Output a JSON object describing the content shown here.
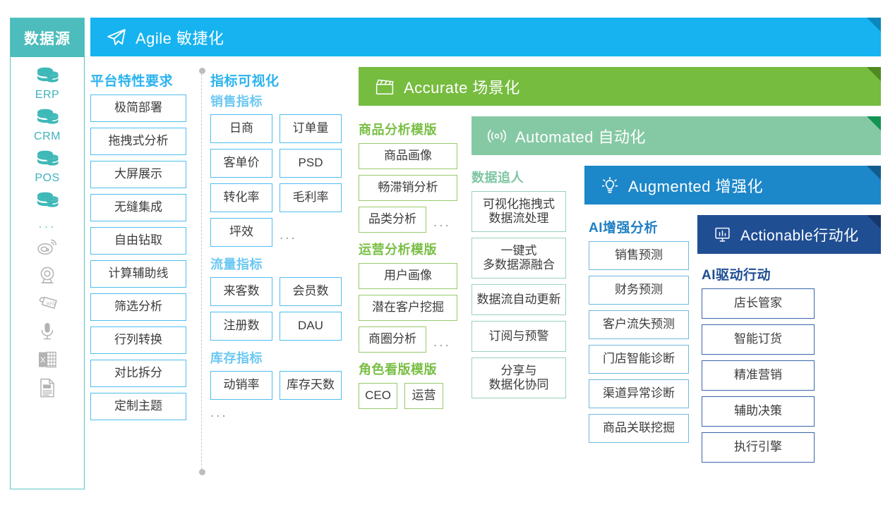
{
  "datasource": {
    "title": "数据源",
    "accent": "#4cbcbc",
    "items": [
      {
        "icon": "database-icon",
        "label": "ERP"
      },
      {
        "icon": "database-icon",
        "label": "CRM"
      },
      {
        "icon": "database-icon",
        "label": "POS"
      },
      {
        "icon": "database-icon",
        "label": ""
      }
    ],
    "ellipsis": "...",
    "gray_icons": [
      {
        "icon": "weibo-icon"
      },
      {
        "icon": "webcam-icon"
      },
      {
        "icon": "rfid-tag-icon"
      },
      {
        "icon": "microphone-icon"
      },
      {
        "icon": "excel-file-icon"
      },
      {
        "icon": "txt-file-icon"
      }
    ]
  },
  "banners": [
    {
      "id": "agile",
      "icon": "paper-plane-icon",
      "label": "Agile 敏捷化",
      "color": "#16b3f0"
    },
    {
      "id": "accurate",
      "icon": "clapperboard-icon",
      "label": "Accurate 场景化",
      "color": "#76bc3f"
    },
    {
      "id": "automated",
      "icon": "radar-signal-icon",
      "label": "Automated 自动化",
      "color": "#85c9a4"
    },
    {
      "id": "augmented",
      "icon": "lightbulb-icon",
      "label": "Augmented 增强化",
      "color": "#1c87c9"
    },
    {
      "id": "actionable",
      "icon": "presentation-chart-icon",
      "label": "Actionable行动化",
      "color": "#1f4e93"
    }
  ],
  "col1": {
    "title": "平台特性要求",
    "accent": "#2bb3ef",
    "items": [
      "极简部署",
      "拖拽式分析",
      "大屏展示",
      "无缝集成",
      "自由钻取",
      "计算辅助线",
      "筛选分析",
      "行列转换",
      "对比拆分",
      "定制主题"
    ]
  },
  "col2": {
    "title": "指标可视化",
    "accent": "#2bb3ef",
    "groups": [
      {
        "title": "销售指标",
        "items": [
          "日商",
          "订单量",
          "客单价",
          "PSD",
          "转化率",
          "毛利率",
          "坪效"
        ],
        "trailing": "..."
      },
      {
        "title": "流量指标",
        "items": [
          "来客数",
          "会员数",
          "注册数",
          "DAU"
        ],
        "trailing": ""
      },
      {
        "title": "库存指标",
        "items": [
          "动销率",
          "库存天数"
        ],
        "trailing": ""
      }
    ],
    "footer_dots": "..."
  },
  "col3": {
    "accent": "#79bf45",
    "groups": [
      {
        "title": "商品分析模版",
        "items": [
          "商品画像",
          "畅滞销分析",
          "品类分析"
        ],
        "trailing": "..."
      },
      {
        "title": "运营分析模版",
        "items": [
          "用户画像",
          "潜在客户挖掘",
          "商圈分析"
        ],
        "trailing": "..."
      },
      {
        "title": "角色看版模版",
        "items": [
          "CEO",
          "运营"
        ],
        "trailing": ""
      }
    ]
  },
  "col4": {
    "title": "数据追人",
    "accent": "#7dc6a2",
    "items": [
      "可视化拖拽式\n数据流处理",
      "一键式\n多数据源融合",
      "数据流自动更新",
      "订阅与预警",
      "分享与\n数据化协同"
    ]
  },
  "col5": {
    "title": "AI增强分析",
    "accent": "#1f7fc2",
    "items": [
      "销售预测",
      "财务预测",
      "客户流失预测",
      "门店智能诊断",
      "渠道异常诊断",
      "商品关联挖掘"
    ]
  },
  "col6": {
    "title": "AI驱动行动",
    "accent": "#1f4e93",
    "items": [
      "店长管家",
      "智能订货",
      "精准营销",
      "辅助决策",
      "执行引擎"
    ]
  }
}
